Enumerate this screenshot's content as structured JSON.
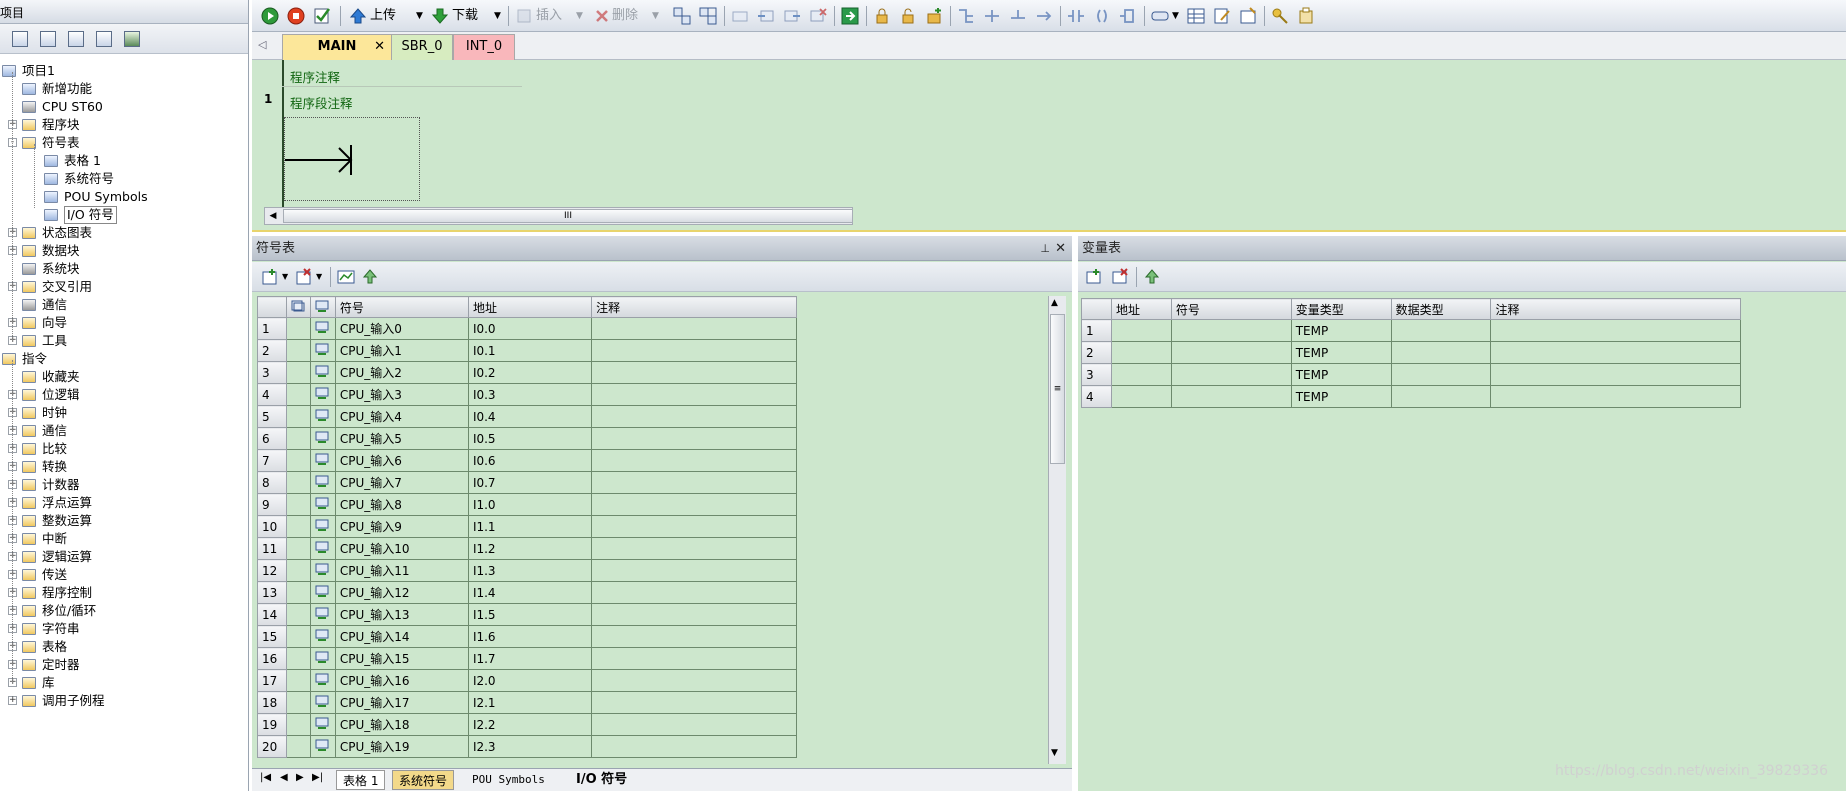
{
  "nav": {
    "title": "项目",
    "tree": [
      {
        "label": "项目1",
        "level": 0,
        "expander": "",
        "icon": "project-icon"
      },
      {
        "label": "新增功能",
        "level": 1,
        "expander": "",
        "icon": "whats-new-icon"
      },
      {
        "label": "CPU ST60",
        "level": 1,
        "expander": "",
        "icon": "cpu-icon"
      },
      {
        "label": "程序块",
        "level": 1,
        "expander": "+",
        "icon": "folder-icon"
      },
      {
        "label": "符号表",
        "level": 1,
        "expander": "-",
        "icon": "folder-icon"
      },
      {
        "label": "表格 1",
        "level": 2,
        "expander": "",
        "icon": "table-icon"
      },
      {
        "label": "系统符号",
        "level": 2,
        "expander": "",
        "icon": "table-icon"
      },
      {
        "label": "POU Symbols",
        "level": 2,
        "expander": "",
        "icon": "table-icon"
      },
      {
        "label": "I/O 符号",
        "level": 2,
        "expander": "",
        "icon": "table-icon",
        "selected": true
      },
      {
        "label": "状态图表",
        "level": 1,
        "expander": "+",
        "icon": "folder-icon"
      },
      {
        "label": "数据块",
        "level": 1,
        "expander": "+",
        "icon": "folder-icon"
      },
      {
        "label": "系统块",
        "level": 1,
        "expander": "",
        "icon": "system-block-icon"
      },
      {
        "label": "交叉引用",
        "level": 1,
        "expander": "+",
        "icon": "folder-icon"
      },
      {
        "label": "通信",
        "level": 1,
        "expander": "",
        "icon": "communication-icon"
      },
      {
        "label": "向导",
        "level": 1,
        "expander": "+",
        "icon": "folder-icon"
      },
      {
        "label": "工具",
        "level": 1,
        "expander": "+",
        "icon": "folder-icon"
      },
      {
        "label": "指令",
        "level": 0,
        "expander": "",
        "icon": "instruction-icon"
      },
      {
        "label": "收藏夹",
        "level": 1,
        "expander": "",
        "icon": "folder-icon"
      },
      {
        "label": "位逻辑",
        "level": 1,
        "expander": "+",
        "icon": "folder-icon"
      },
      {
        "label": "时钟",
        "level": 1,
        "expander": "+",
        "icon": "clock-icon"
      },
      {
        "label": "通信",
        "level": 1,
        "expander": "+",
        "icon": "folder-icon"
      },
      {
        "label": "比较",
        "level": 1,
        "expander": "+",
        "icon": "folder-icon"
      },
      {
        "label": "转换",
        "level": 1,
        "expander": "+",
        "icon": "folder-icon"
      },
      {
        "label": "计数器",
        "level": 1,
        "expander": "+",
        "icon": "folder-icon"
      },
      {
        "label": "浮点运算",
        "level": 1,
        "expander": "+",
        "icon": "folder-icon"
      },
      {
        "label": "整数运算",
        "level": 1,
        "expander": "+",
        "icon": "folder-icon"
      },
      {
        "label": "中断",
        "level": 1,
        "expander": "+",
        "icon": "folder-icon"
      },
      {
        "label": "逻辑运算",
        "level": 1,
        "expander": "+",
        "icon": "folder-icon"
      },
      {
        "label": "传送",
        "level": 1,
        "expander": "+",
        "icon": "folder-icon"
      },
      {
        "label": "程序控制",
        "level": 1,
        "expander": "+",
        "icon": "folder-icon"
      },
      {
        "label": "移位/循环",
        "level": 1,
        "expander": "+",
        "icon": "folder-icon"
      },
      {
        "label": "字符串",
        "level": 1,
        "expander": "+",
        "icon": "folder-icon"
      },
      {
        "label": "表格",
        "level": 1,
        "expander": "+",
        "icon": "folder-icon"
      },
      {
        "label": "定时器",
        "level": 1,
        "expander": "+",
        "icon": "folder-icon"
      },
      {
        "label": "库",
        "level": 1,
        "expander": "+",
        "icon": "folder-icon"
      },
      {
        "label": "调用子例程",
        "level": 1,
        "expander": "+",
        "icon": "folder-icon"
      }
    ]
  },
  "toolbar": {
    "upload_label": "上传",
    "download_label": "下载",
    "insert_label": "插入",
    "delete_label": "删除"
  },
  "editor": {
    "tabs": [
      {
        "label": "MAIN",
        "color": "#fce79a",
        "active": true
      },
      {
        "label": "SBR_0",
        "color": "#d7ecc0",
        "active": false
      },
      {
        "label": "INT_0",
        "color": "#f9b7bb",
        "active": false
      }
    ],
    "close_glyph": "✕",
    "program_comment": "程序注释",
    "network_number": "1",
    "network_comment": "程序段注释",
    "scroll_grip": "III"
  },
  "symbol_table": {
    "title": "符号表",
    "columns": [
      "符号",
      "地址",
      "注释"
    ],
    "rows": [
      {
        "n": "1",
        "symbol": "CPU_输入0",
        "address": "I0.0",
        "comment": ""
      },
      {
        "n": "2",
        "symbol": "CPU_输入1",
        "address": "I0.1",
        "comment": ""
      },
      {
        "n": "3",
        "symbol": "CPU_输入2",
        "address": "I0.2",
        "comment": ""
      },
      {
        "n": "4",
        "symbol": "CPU_输入3",
        "address": "I0.3",
        "comment": ""
      },
      {
        "n": "5",
        "symbol": "CPU_输入4",
        "address": "I0.4",
        "comment": ""
      },
      {
        "n": "6",
        "symbol": "CPU_输入5",
        "address": "I0.5",
        "comment": ""
      },
      {
        "n": "7",
        "symbol": "CPU_输入6",
        "address": "I0.6",
        "comment": ""
      },
      {
        "n": "8",
        "symbol": "CPU_输入7",
        "address": "I0.7",
        "comment": ""
      },
      {
        "n": "9",
        "symbol": "CPU_输入8",
        "address": "I1.0",
        "comment": ""
      },
      {
        "n": "10",
        "symbol": "CPU_输入9",
        "address": "I1.1",
        "comment": ""
      },
      {
        "n": "11",
        "symbol": "CPU_输入10",
        "address": "I1.2",
        "comment": ""
      },
      {
        "n": "12",
        "symbol": "CPU_输入11",
        "address": "I1.3",
        "comment": ""
      },
      {
        "n": "13",
        "symbol": "CPU_输入12",
        "address": "I1.4",
        "comment": ""
      },
      {
        "n": "14",
        "symbol": "CPU_输入13",
        "address": "I1.5",
        "comment": ""
      },
      {
        "n": "15",
        "symbol": "CPU_输入14",
        "address": "I1.6",
        "comment": ""
      },
      {
        "n": "16",
        "symbol": "CPU_输入15",
        "address": "I1.7",
        "comment": ""
      },
      {
        "n": "17",
        "symbol": "CPU_输入16",
        "address": "I2.0",
        "comment": ""
      },
      {
        "n": "18",
        "symbol": "CPU_输入17",
        "address": "I2.1",
        "comment": ""
      },
      {
        "n": "19",
        "symbol": "CPU_输入18",
        "address": "I2.2",
        "comment": ""
      },
      {
        "n": "20",
        "symbol": "CPU_输入19",
        "address": "I2.3",
        "comment": ""
      }
    ],
    "sheet_tabs": [
      "表格 1",
      "系统符号",
      "POU Symbols",
      "I/O 符号"
    ],
    "active_sheet": "I/O 符号"
  },
  "variable_table": {
    "title": "变量表",
    "columns": [
      "地址",
      "符号",
      "变量类型",
      "数据类型",
      "注释"
    ],
    "rows": [
      {
        "n": "1",
        "address": "",
        "symbol": "",
        "var_type": "TEMP",
        "data_type": "",
        "comment": ""
      },
      {
        "n": "2",
        "address": "",
        "symbol": "",
        "var_type": "TEMP",
        "data_type": "",
        "comment": ""
      },
      {
        "n": "3",
        "address": "",
        "symbol": "",
        "var_type": "TEMP",
        "data_type": "",
        "comment": ""
      },
      {
        "n": "4",
        "address": "",
        "symbol": "",
        "var_type": "TEMP",
        "data_type": "",
        "comment": ""
      }
    ]
  },
  "watermark": "https://blog.csdn.net/weixin_39829336"
}
